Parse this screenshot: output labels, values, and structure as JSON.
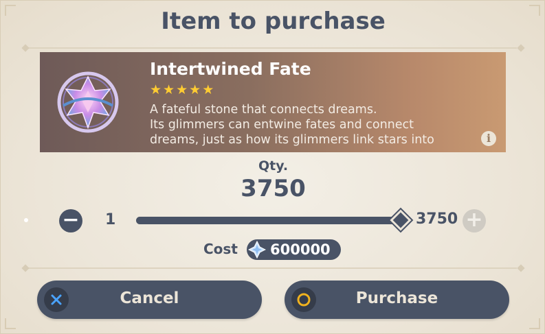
{
  "dialog": {
    "title": "Item to purchase"
  },
  "item": {
    "name": "Intertwined Fate",
    "rarity_stars": 5,
    "description_lines": [
      "A fateful stone that connects dreams.",
      "Its glimmers can entwine fates and connect",
      "dreams, just as how its glimmers link stars into"
    ],
    "icon": "intertwined-fate-icon"
  },
  "quantity": {
    "label": "Qty.",
    "value": "3750",
    "min_label": "1",
    "max_label": "3750",
    "slider_fraction": 1.0
  },
  "cost": {
    "label": "Cost",
    "value": "600000",
    "currency_icon": "primogem-icon"
  },
  "buttons": {
    "cancel": {
      "label": "Cancel",
      "icon": "cross-button-icon"
    },
    "purchase": {
      "label": "Purchase",
      "icon": "circle-button-icon"
    }
  },
  "colors": {
    "text_dark": "#495366",
    "star": "#ffcc32",
    "background": "#ece5d8"
  }
}
